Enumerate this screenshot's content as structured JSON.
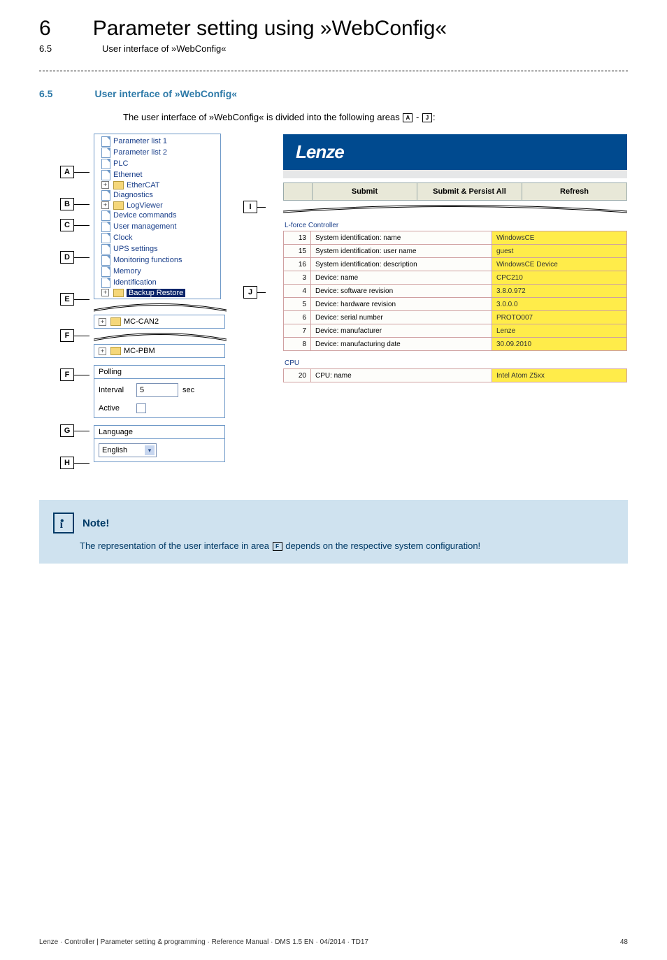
{
  "chapter": {
    "num": "6",
    "title": "Parameter setting using »WebConfig«"
  },
  "subsection_top": {
    "num": "6.5",
    "title": "User interface of »WebConfig«"
  },
  "section": {
    "num": "6.5",
    "title": "User interface of »WebConfig«"
  },
  "intro": {
    "prefix": "The user interface of »WebConfig« is divided into the following areas ",
    "a": "A",
    "dash": " - ",
    "j": "J",
    "suffix": ":"
  },
  "tree": {
    "items": [
      "Parameter list 1",
      "Parameter list 2",
      "PLC",
      "Ethernet",
      "EtherCAT",
      "Diagnostics",
      "LogViewer",
      "Device commands",
      "User management",
      "Clock",
      "UPS settings",
      "Monitoring functions",
      "Memory",
      "Identification",
      "Backup Restore"
    ],
    "types": [
      "file",
      "file",
      "file",
      "file",
      "folder",
      "file",
      "folder",
      "file",
      "file",
      "file",
      "file",
      "file",
      "file",
      "file",
      "folder"
    ]
  },
  "panels": {
    "mc_can2": "MC-CAN2",
    "mc_pbm": "MC-PBM",
    "polling_title": "Polling",
    "interval_label": "Interval",
    "interval_value": "5",
    "interval_unit": "sec",
    "active_label": "Active",
    "language_title": "Language",
    "language_value": "English"
  },
  "brand": "Lenze",
  "toolbar": {
    "submit": "Submit",
    "submit_persist": "Submit & Persist All",
    "refresh": "Refresh"
  },
  "group1_title": "L-force Controller",
  "group1": [
    {
      "idx": "13",
      "label": "System identification: name",
      "val": "WindowsCE"
    },
    {
      "idx": "15",
      "label": "System identification: user name",
      "val": "guest"
    },
    {
      "idx": "16",
      "label": "System identification: description",
      "val": "WindowsCE Device"
    },
    {
      "idx": "3",
      "label": "Device: name",
      "val": "CPC210"
    },
    {
      "idx": "4",
      "label": "Device: software revision",
      "val": "3.8.0.972"
    },
    {
      "idx": "5",
      "label": "Device: hardware revision",
      "val": "3.0.0.0"
    },
    {
      "idx": "6",
      "label": "Device: serial number",
      "val": "PROTO007"
    },
    {
      "idx": "7",
      "label": "Device: manufacturer",
      "val": "Lenze"
    },
    {
      "idx": "8",
      "label": "Device: manufacturing date",
      "val": "30.09.2010"
    }
  ],
  "group2_title": "CPU",
  "group2": [
    {
      "idx": "20",
      "label": "CPU: name",
      "val": "Intel Atom Z5xx"
    }
  ],
  "note": {
    "title": "Note!",
    "prefix": "The representation of the user interface in area ",
    "f": "F",
    "suffix": " depends on the respective system configuration!"
  },
  "footer": {
    "left": "Lenze · Controller | Parameter setting & programming · Reference Manual · DMS 1.5 EN · 04/2014 · TD17",
    "right": "48"
  },
  "letters": {
    "A": "A",
    "B": "B",
    "C": "C",
    "D": "D",
    "E": "E",
    "F": "F",
    "G": "G",
    "H": "H",
    "I": "I",
    "J": "J"
  }
}
